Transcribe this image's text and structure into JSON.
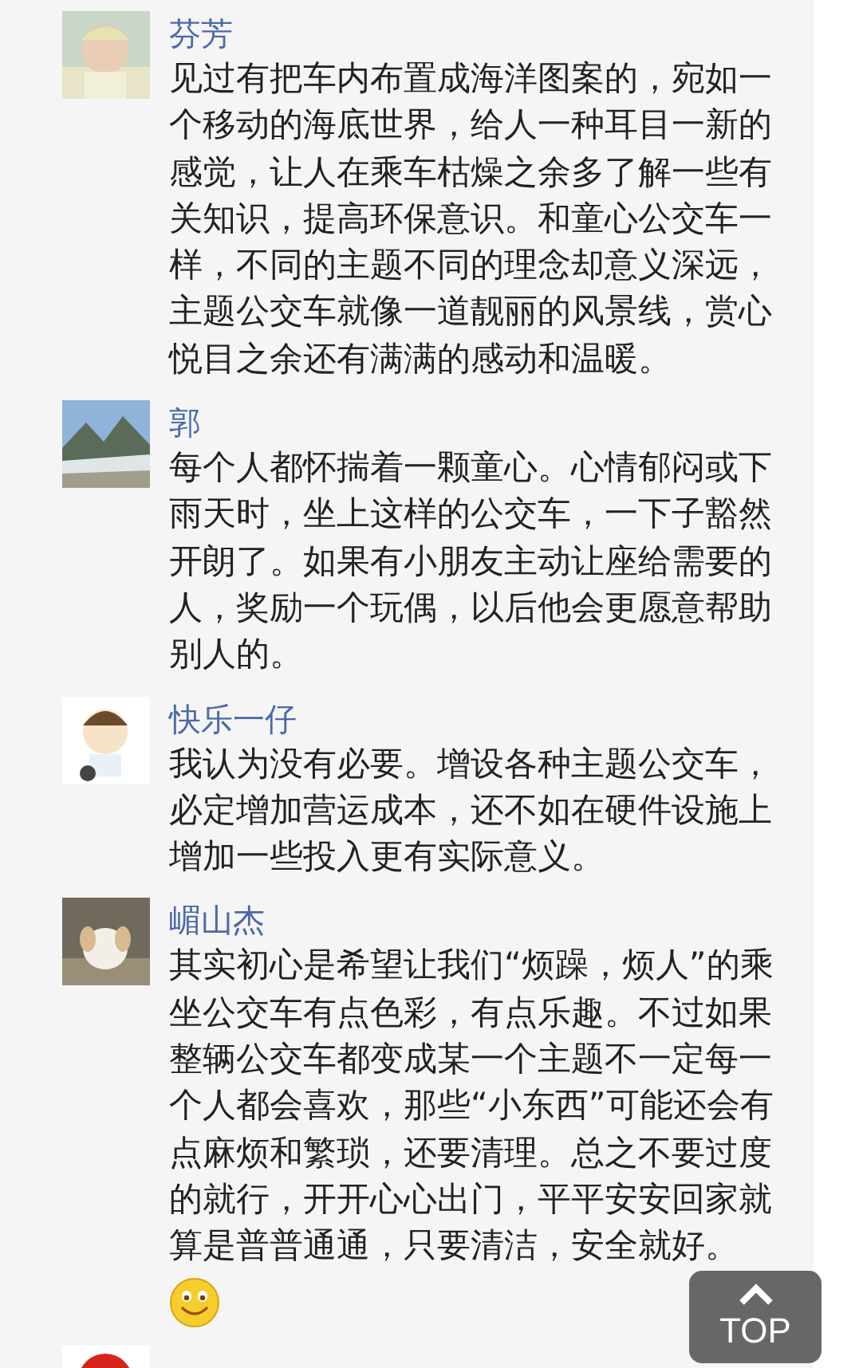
{
  "comments": [
    {
      "name": "芬芳",
      "avatar": {
        "kind": "picture"
      },
      "text": "见过有把车内布置成海洋图案的，宛如一个移动的海底世界，给人一种耳目一新的感觉，让人在乘车枯燥之余多了解一些有关知识，提高环保意识。和童心公交车一样，不同的主题不同的理念却意义深远，主题公交车就像一道靓丽的风景线，赏心悦目之余还有满满的感动和温暖。"
    },
    {
      "name": "郭",
      "avatar": {
        "kind": "picture"
      },
      "text": "每个人都怀揣着一颗童心。心情郁闷或下雨天时，坐上这样的公交车，一下子豁然开朗了。如果有小朋友主动让座给需要的人，奖励一个玩偶，以后他会更愿意帮助别人的。"
    },
    {
      "name": "快乐一仔",
      "avatar": {
        "kind": "picture"
      },
      "text": "我认为没有必要。增设各种主题公交车，必定增加营运成本，还不如在硬件设施上增加一些投入更有实际意义。"
    },
    {
      "name": "嵋山杰",
      "avatar": {
        "kind": "picture"
      },
      "text": "其实初心是希望让我们“烦躁，烦人”的乘坐公交车有点色彩，有点乐趣。不过如果整辆公交车都变成某一个主题不一定每一个人都会喜欢，那些“小东西”可能还会有点麻烦和繁琐，还要清理。总之不要过度的就行，开开心心出门，平平安安回家就算是普普通通，只要清洁，安全就好。",
      "attachments": [
        {
          "kind": "smiley"
        }
      ]
    },
    {
      "avatar": {
        "kind": "picture"
      }
    }
  ],
  "top_button": {
    "label": "TOP"
  }
}
